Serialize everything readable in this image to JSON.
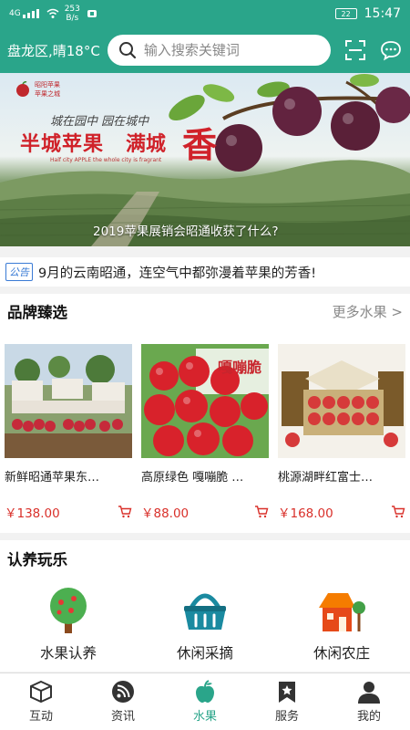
{
  "status_bar": {
    "network": "4G",
    "speed_value": "253",
    "speed_unit": "B/s",
    "battery": "22",
    "time": "15:47"
  },
  "header": {
    "location": "盘龙区,晴18°C",
    "search_placeholder": "输入搜索关键词"
  },
  "banner": {
    "logo_line1": "昭阳苹果",
    "logo_line2": "苹果之城",
    "slogan": "城在园中 园在城中",
    "title_part1": "半城苹果",
    "title_part2": "满城",
    "title_part3": "香",
    "subtitle": "Half city APPLE the whole city is fragrant",
    "caption": "2019苹果展销会昭通收获了什么?"
  },
  "notice": {
    "tag": "公告",
    "text": "9月的云南昭通，连空气中都弥漫着苹果的芳香!"
  },
  "brand_section": {
    "title": "品牌臻选",
    "more": "更多水果 >",
    "products": [
      {
        "name": "新鲜昭通苹果东…",
        "price": "￥138.00"
      },
      {
        "name": "高原绿色 嘎嘣脆 …",
        "price": "￥88.00",
        "sign": "嘎嘣脆"
      },
      {
        "name": "桃源湖畔红富士…",
        "price": "￥168.00"
      }
    ]
  },
  "play_section": {
    "title": "认养玩乐",
    "items": [
      {
        "label": "水果认养",
        "icon": "tree-icon"
      },
      {
        "label": "休闲采摘",
        "icon": "basket-icon"
      },
      {
        "label": "休闲农庄",
        "icon": "farmhouse-icon"
      }
    ]
  },
  "tabbar": {
    "items": [
      {
        "label": "互动",
        "icon": "box-icon"
      },
      {
        "label": "资讯",
        "icon": "rss-icon"
      },
      {
        "label": "水果",
        "icon": "apple-icon",
        "active": true
      },
      {
        "label": "服务",
        "icon": "star-bookmark-icon"
      },
      {
        "label": "我的",
        "icon": "user-icon"
      }
    ]
  },
  "colors": {
    "primary": "#2aa58a",
    "price": "#d9302a",
    "notice_tag": "#3a7bd5"
  }
}
